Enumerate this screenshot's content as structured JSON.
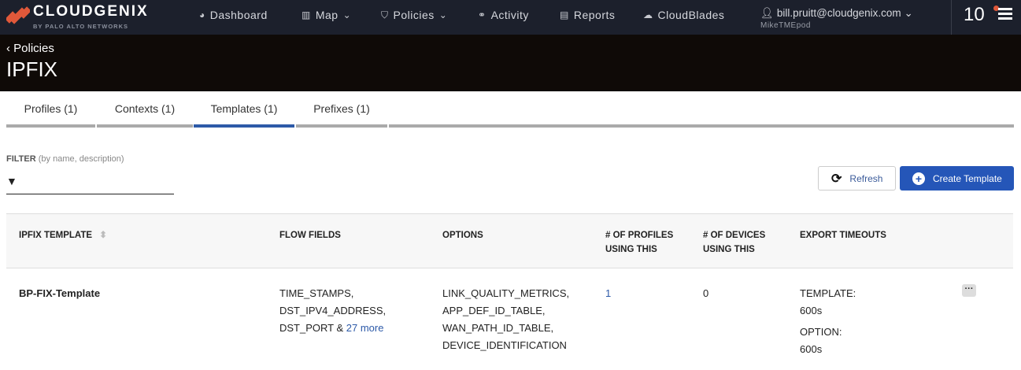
{
  "nav": {
    "brand": "CLOUDGENIX",
    "brand_sub": "BY PALO ALTO NETWORKS",
    "items": [
      {
        "label": "Dashboard",
        "icon": "dashboard-icon"
      },
      {
        "label": "Map",
        "icon": "map-icon"
      },
      {
        "label": "Policies",
        "icon": "shield-icon"
      },
      {
        "label": "Activity",
        "icon": "binoculars-icon"
      },
      {
        "label": "Reports",
        "icon": "report-icon"
      },
      {
        "label": "CloudBlades",
        "icon": "cloud-icon"
      }
    ],
    "user": "bill.pruitt@cloudgenix.com",
    "tenant": "MikeTMEpod",
    "notification_count": "10"
  },
  "header": {
    "back": "Policies",
    "title": "IPFIX"
  },
  "tabs": [
    {
      "label": "Profiles (1)"
    },
    {
      "label": "Contexts (1)"
    },
    {
      "label": "Templates (1)",
      "active": true
    },
    {
      "label": "Prefixes (1)"
    }
  ],
  "filter": {
    "label": "FILTER",
    "hint": "(by name, description)",
    "value": ""
  },
  "buttons": {
    "refresh": "Refresh",
    "create": "Create Template"
  },
  "colors": {
    "accent": "#2556b8",
    "nav_bg": "#1c202c",
    "header_bg": "#0f0a07"
  },
  "table": {
    "headers": [
      "IPFIX TEMPLATE",
      "FLOW FIELDS",
      "OPTIONS",
      "# OF PROFILES USING THIS",
      "# OF DEVICES USING THIS",
      "EXPORT TIMEOUTS"
    ],
    "rows": [
      {
        "name": "BP-FIX-Template",
        "flow_fields": [
          "TIME_STAMPS,",
          "DST_IPV4_ADDRESS,",
          "DST_PORT &"
        ],
        "flow_more": "27 more",
        "options": [
          "LINK_QUALITY_METRICS,",
          "APP_DEF_ID_TABLE,",
          "WAN_PATH_ID_TABLE,",
          "DEVICE_IDENTIFICATION"
        ],
        "profiles": "1",
        "devices": "0",
        "timeouts": [
          "TEMPLATE:",
          "600s",
          "OPTION:",
          "600s"
        ],
        "actions": "···"
      }
    ]
  }
}
